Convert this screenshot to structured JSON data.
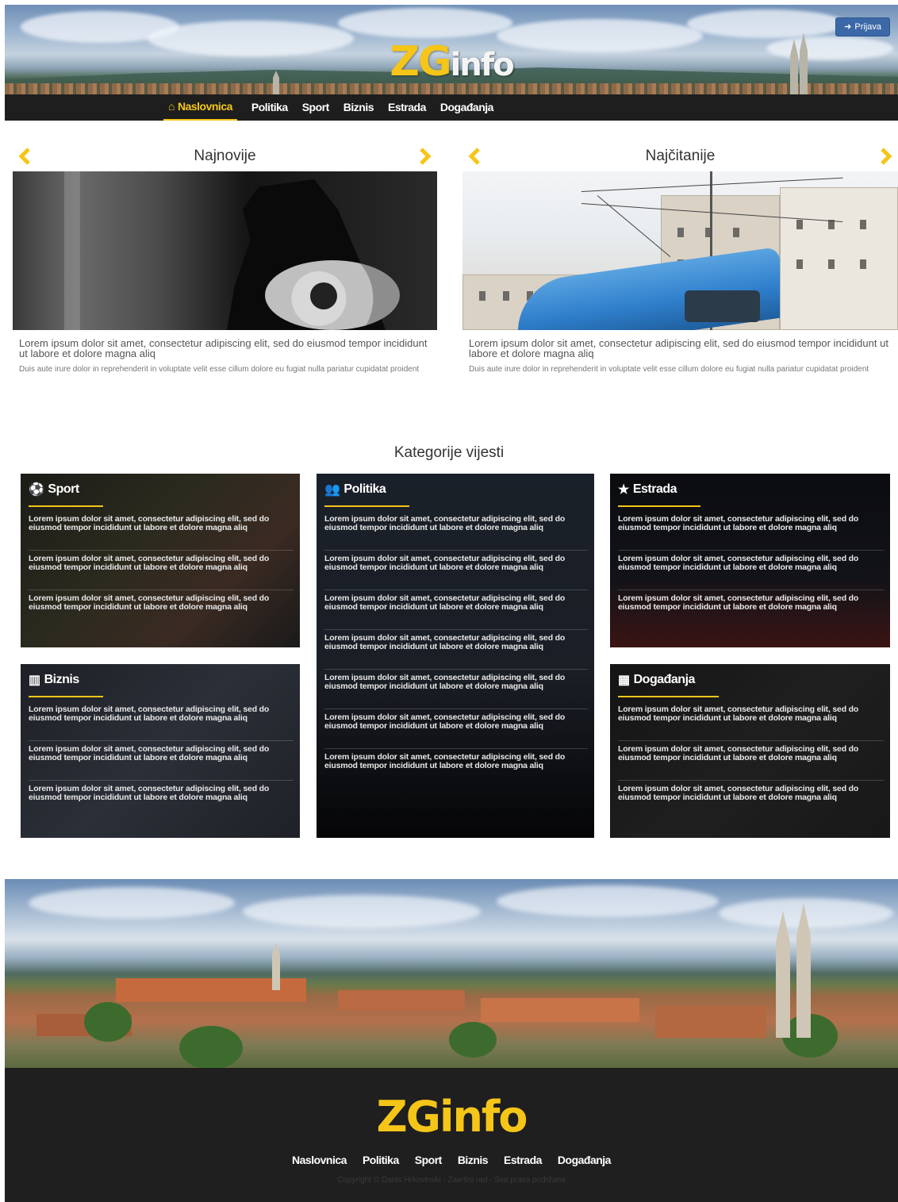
{
  "header": {
    "logo_zg": "ZG",
    "logo_info": "info",
    "login_label": "Prijava"
  },
  "nav": {
    "items": [
      {
        "label": "Naslovnica",
        "icon": "home-icon",
        "active": true
      },
      {
        "label": "Politika"
      },
      {
        "label": "Sport"
      },
      {
        "label": "Biznis"
      },
      {
        "label": "Estrada"
      },
      {
        "label": "Događanja"
      }
    ]
  },
  "featured": [
    {
      "title": "Najnovije",
      "lead": "Lorem ipsum dolor sit amet, consectetur adipiscing elit, sed do eiusmod tempor incididunt ut labore et dolore magna aliq",
      "sub": "Duis aute irure dolor in reprehenderit in voluptate velit esse cillum dolore eu fugiat nulla pariatur cupidatat proident"
    },
    {
      "title": "Najčitanije",
      "lead": "Lorem ipsum dolor sit amet, consectetur adipiscing elit, sed do eiusmod tempor incididunt ut labore et dolore magna aliq",
      "sub": "Duis aute irure dolor in reprehenderit in voluptate velit esse cillum dolore eu fugiat nulla pariatur cupidatat proident"
    }
  ],
  "categories": {
    "title": "Kategorije vijesti",
    "item_text": "Lorem ipsum dolor sit amet, consectetur adipiscing elit, sed do eiusmod tempor incididunt ut labore et dolore magna aliq",
    "cards": [
      {
        "name": "Sport",
        "icon": "soccer-ball-icon"
      },
      {
        "name": "Politika",
        "icon": "users-icon"
      },
      {
        "name": "Estrada",
        "icon": "star-icon"
      },
      {
        "name": "Biznis",
        "icon": "bar-chart-icon"
      },
      {
        "name": "Događanja",
        "icon": "calendar-icon"
      }
    ]
  },
  "footer": {
    "logo": "ZGinfo",
    "nav": [
      "Naslovnica",
      "Politika",
      "Sport",
      "Biznis",
      "Estrada",
      "Događanja"
    ],
    "copyright": "Copyright © Danis Hrkovinski - Završni rad - Sva prava pridržana"
  },
  "colors": {
    "accent": "#f5c518",
    "nav_bg": "#1e1e1e",
    "login_button": "#3c68a8"
  }
}
